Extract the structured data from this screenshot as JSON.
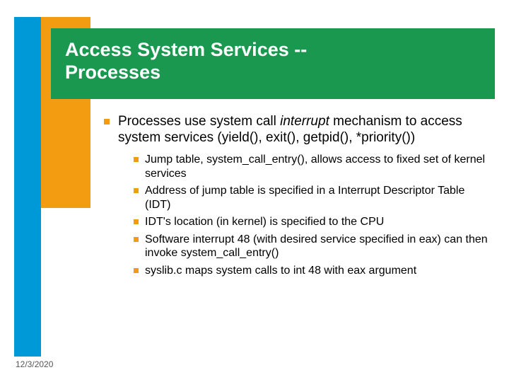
{
  "header": {
    "title_line1": "Access System Services --",
    "title_line2": "Processes"
  },
  "bullets": {
    "lvl1_pre": "Processes use system call ",
    "lvl1_ital": "interrupt",
    "lvl1_post": " mechanism to access system services (yield(), exit(), getpid(), *priority())",
    "lvl2": [
      "Jump table, system_call_entry(), allows access to fixed set of kernel services",
      "Address of jump table is specified in a Interrupt Descriptor Table (IDT)",
      "IDT's location (in kernel) is specified to the CPU",
      "Software interrupt 48 (with desired service specified in eax) can then invoke system_call_entry()",
      "syslib.c maps system calls to int 48 with eax argument"
    ]
  },
  "footer": {
    "date": "12/3/2020"
  }
}
